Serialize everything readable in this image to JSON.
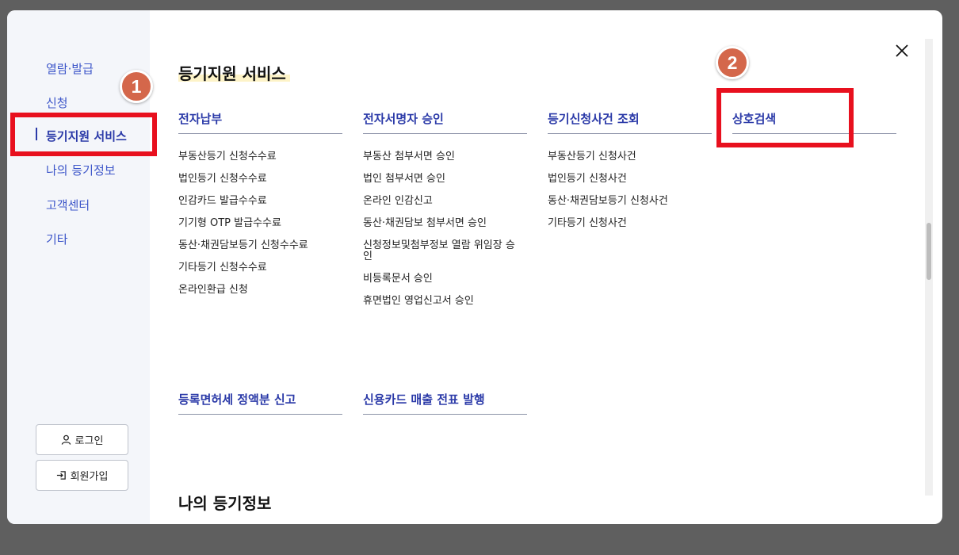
{
  "sidebar": {
    "items": [
      {
        "label": "열람·발급"
      },
      {
        "label": "신청"
      },
      {
        "label": "등기지원 서비스"
      },
      {
        "label": "나의 등기정보"
      },
      {
        "label": "고객센터"
      },
      {
        "label": "기타"
      }
    ],
    "login_label": "로그인",
    "signup_label": "회원가입"
  },
  "annotations": {
    "badge1": "1",
    "badge2": "2",
    "accent_color": "#e8101e"
  },
  "main": {
    "title": "등기지원 서비스",
    "columns": [
      {
        "heading": "전자납부",
        "links": [
          "부동산등기 신청수수료",
          "법인등기 신청수수료",
          "인감카드 발급수수료",
          "기기형 OTP 발급수수료",
          "동산·채권담보등기 신청수수료",
          "기타등기 신청수수료",
          "온라인환급 신청"
        ]
      },
      {
        "heading": "전자서명자 승인",
        "links": [
          "부동산 첨부서면 승인",
          "법인 첨부서면 승인",
          "온라인 인감신고",
          "동산·채권담보 첨부서면 승인",
          "신청정보및첨부정보 열람 위임장 승인",
          "비등록문서 승인",
          "휴면법인 영업신고서 승인"
        ]
      },
      {
        "heading": "등기신청사건 조회",
        "links": [
          "부동산등기 신청사건",
          "법인등기 신청사건",
          "동산·채권담보등기 신청사건",
          "기타등기 신청사건"
        ]
      },
      {
        "heading": "상호검색",
        "links": []
      }
    ],
    "row2": [
      {
        "heading": "등록면허세 정액분 신고"
      },
      {
        "heading": "신용카드 매출 전표 발행"
      }
    ],
    "next_section_title": "나의 등기정보"
  }
}
